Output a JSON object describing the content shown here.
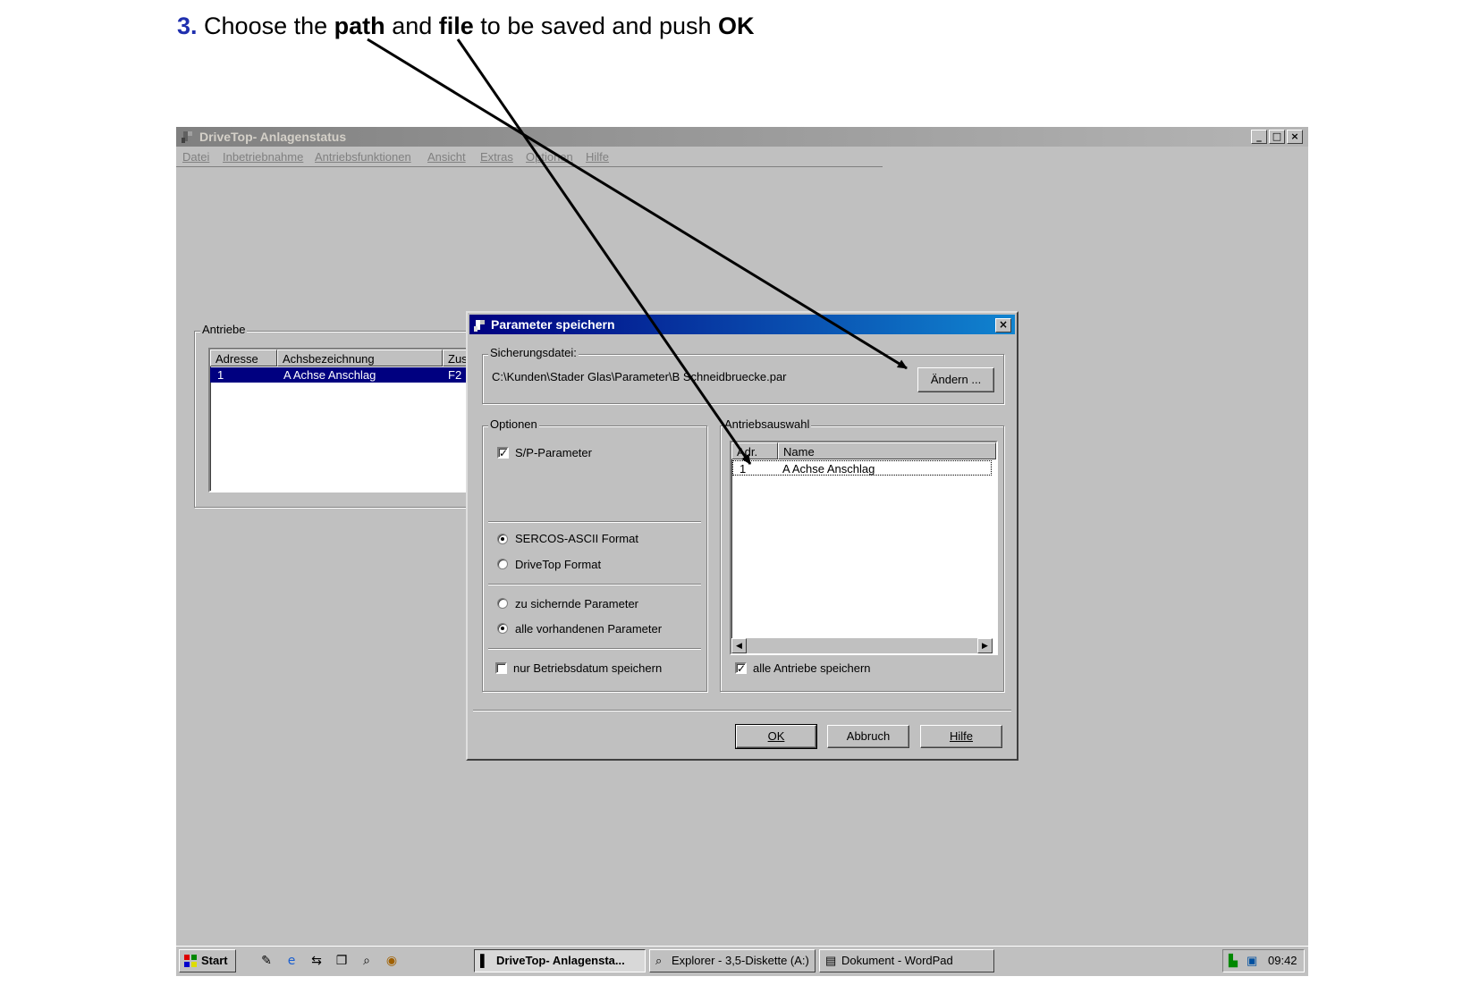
{
  "instruction": {
    "number": "3.",
    "text_1": "Choose the",
    "bold_1": "path",
    "text_2": "and",
    "bold_2": "file",
    "text_3": "to be saved and push",
    "bold_3": "OK"
  },
  "main_window": {
    "title": "DriveTop- Anlagenstatus",
    "menu": [
      "Datei",
      "Inbetriebnahme",
      "Antriebsfunktionen",
      "Ansicht",
      "Extras",
      "Optionen",
      "Hilfe"
    ],
    "controls": {
      "minimize": "_",
      "maximize": "□",
      "close": "×"
    }
  },
  "antriebe": {
    "group_label": "Antriebe",
    "columns": [
      "Adresse",
      "Achsbezeichnung",
      "Zus"
    ],
    "rows": [
      {
        "adresse": "1",
        "name": "A Achse Anschlag",
        "zus": "F2"
      }
    ]
  },
  "dialog": {
    "title": "Parameter speichern",
    "close": "×",
    "sicherung": {
      "group_label": "Sicherungsdatei:",
      "path": "C:\\Kunden\\Stader Glas\\Parameter\\B Schneidbruecke.par",
      "change_button": "Ändern ..."
    },
    "optionen": {
      "group_label": "Optionen",
      "sp_parameter": {
        "label": "S/P-Parameter",
        "checked": true
      },
      "format_ascii": {
        "label": "SERCOS-ASCII Format",
        "selected": true
      },
      "format_drivetop": {
        "label": "DriveTop Format",
        "selected": false
      },
      "param_zu_sichernde": {
        "label": "zu sichernde Parameter",
        "selected": false
      },
      "param_alle": {
        "label": "alle vorhandenen Parameter",
        "selected": true
      },
      "nur_betriebsdatum": {
        "label": "nur Betriebsdatum speichern",
        "checked": false
      }
    },
    "antriebsauswahl": {
      "group_label": "Antriebsauswahl",
      "columns": [
        "Adr.",
        "Name"
      ],
      "rows": [
        {
          "adr": "1",
          "name": "A Achse Anschlag"
        }
      ],
      "alle_antriebe": {
        "label": "alle Antriebe speichern",
        "checked": true
      }
    },
    "buttons": {
      "ok": "OK",
      "cancel": "Abbruch",
      "help": "Hilfe"
    }
  },
  "taskbar": {
    "start": "Start",
    "tasks": [
      "DriveTop- Anlagensta...",
      "Explorer - 3,5-Diskette (A:)",
      "Dokument - WordPad"
    ],
    "clock": "09:42"
  }
}
